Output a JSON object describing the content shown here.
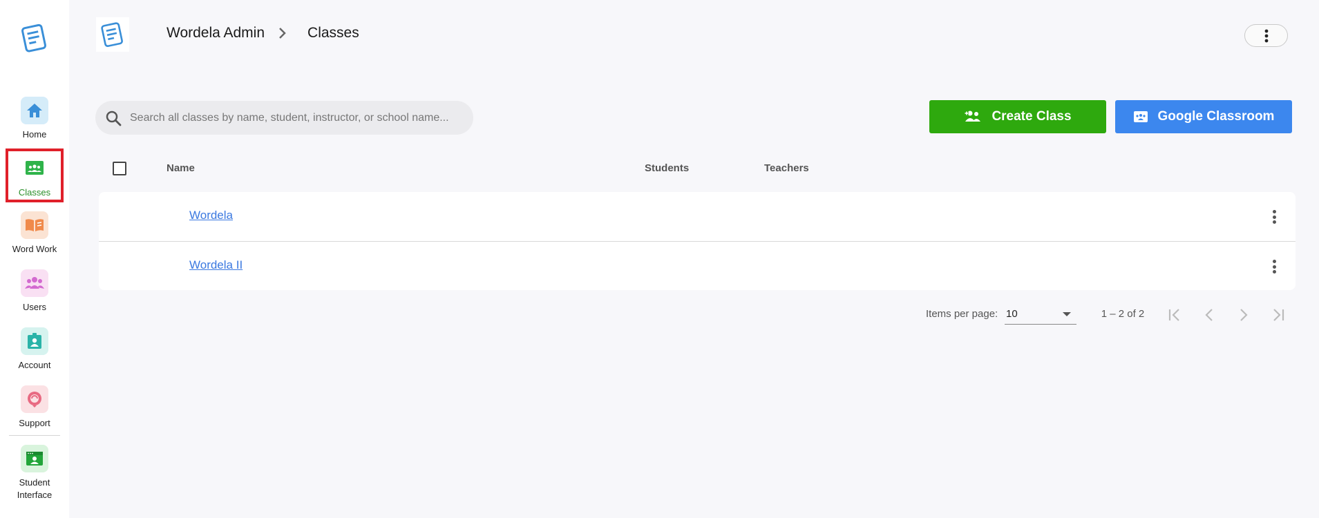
{
  "sidebar": {
    "items": [
      {
        "label": "Home",
        "bg": "#d5ecf9",
        "color": "#3a8fd8"
      },
      {
        "label": "Classes",
        "bg": "#2fb34a",
        "color": "#ffffff",
        "active": true
      },
      {
        "label": "Word Work",
        "bg": "#fbe3d3",
        "color": "#f08a4b"
      },
      {
        "label": "Users",
        "bg": "#f9e0f3",
        "color": "#d36ad0"
      },
      {
        "label": "Account",
        "bg": "#d6f3ef",
        "color": "#2ab3a8"
      },
      {
        "label": "Support",
        "bg": "#fbe1e4",
        "color": "#e86a82"
      },
      {
        "label": "Student Interface",
        "bg": "#d9f4dd",
        "color": "#22a53a"
      }
    ],
    "active_highlight_color": "#e0202a"
  },
  "header": {
    "breadcrumb": [
      "Wordela Admin",
      "Classes"
    ]
  },
  "toolbar": {
    "search_placeholder": "Search all classes by name, student, instructor, or school name...",
    "create_label": "Create Class",
    "google_label": "Google Classroom"
  },
  "table": {
    "columns": [
      "Name",
      "Students",
      "Teachers"
    ],
    "rows": [
      {
        "name": "Wordela"
      },
      {
        "name": "Wordela II"
      }
    ]
  },
  "paginator": {
    "items_per_page_label": "Items per page:",
    "page_size": "10",
    "range_label": "1 – 2 of 2"
  },
  "colors": {
    "create_button": "#2ea90e",
    "google_button": "#3c87ee",
    "link": "#3a78e0"
  }
}
